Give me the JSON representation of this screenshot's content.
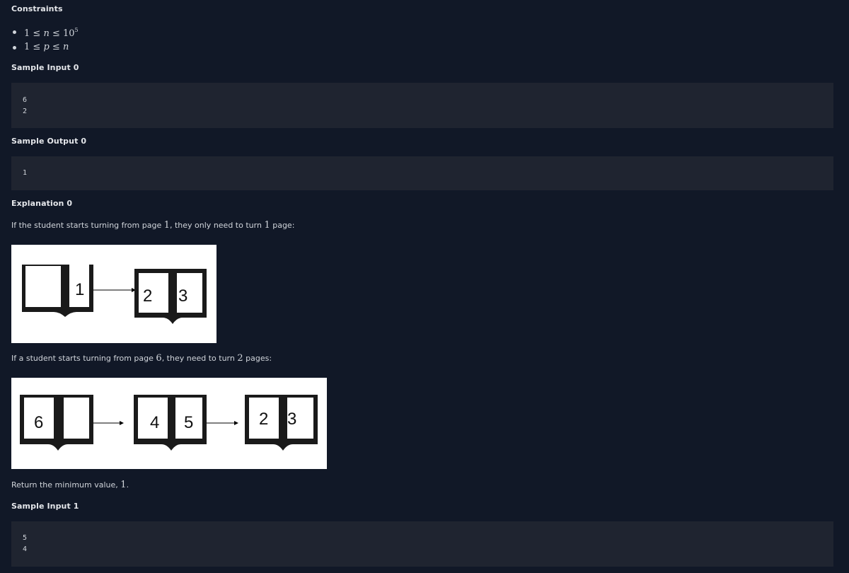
{
  "constraints": {
    "title": "Constraints",
    "items": [
      {
        "prefix": "1 ≤ ",
        "var": "n",
        "mid": " ≤ 10",
        "sup": "5"
      },
      {
        "prefix": "1 ≤ ",
        "var": "p",
        "mid": " ≤ ",
        "var2": "n"
      }
    ]
  },
  "sample_input_0": {
    "title": "Sample Input 0",
    "lines": [
      "6",
      "2"
    ]
  },
  "sample_output_0": {
    "title": "Sample Output 0",
    "lines": [
      "1"
    ]
  },
  "explanation_0": {
    "title": "Explanation 0",
    "para1": {
      "text_a": "If the student starts turning from page ",
      "num_a": "1",
      "text_b": ", they only need to turn ",
      "num_b": "1",
      "text_c": " page:"
    },
    "figure1": {
      "book1_page": "1",
      "book2_left": "2",
      "book2_right": "3"
    },
    "para2": {
      "text_a": "If a student starts turning from page ",
      "num_a": "6",
      "text_b": ", they need to turn ",
      "num_b": "2",
      "text_c": " pages:"
    },
    "figure2": {
      "book1_page": "6",
      "book2_left": "4",
      "book2_right": "5",
      "book3_left": "2",
      "book3_right": "3"
    },
    "para3": {
      "text_a": "Return the minimum value, ",
      "num_a": "1",
      "text_b": "."
    }
  },
  "sample_input_1": {
    "title": "Sample Input 1",
    "lines": [
      "5",
      "4"
    ]
  },
  "colors": {
    "background": "#111827",
    "code_background": "#1f2430",
    "text": "#d1d5db",
    "heading": "#e5e7eb"
  }
}
